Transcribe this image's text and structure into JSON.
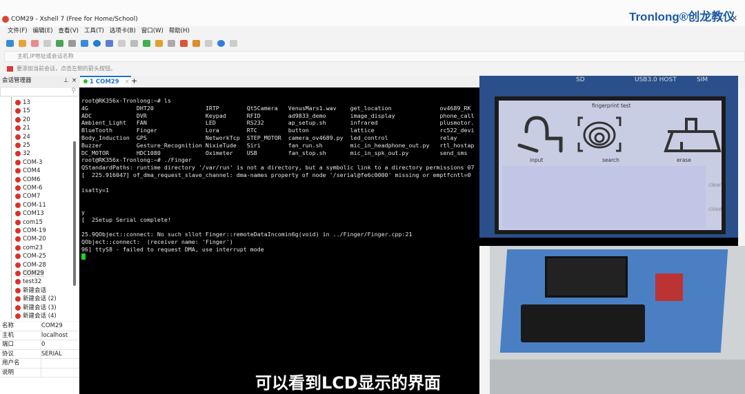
{
  "window": {
    "title": "COM29 - Xshell 7 (Free for Home/School)",
    "logo": "Tronlong®创龙教仪"
  },
  "menu": [
    "文件(F)",
    "编辑(E)",
    "查看(V)",
    "工具(T)",
    "选项卡(B)",
    "窗口(W)",
    "帮助(H)"
  ],
  "address_placeholder": "主机,IP地址或会话名称",
  "hint": "要添加当前会话，点击左侧的箭头按钮。",
  "session_manager": {
    "title": "会话管理器",
    "items": [
      "13",
      "15",
      "20",
      "21",
      "24",
      "25",
      "32",
      "COM-3",
      "COM4",
      "COM6",
      "COM-6",
      "COM7",
      "COM-11",
      "COM13",
      "com15",
      "COM-19",
      "COM-20",
      "com23",
      "COM-25",
      "COM-28",
      "COM29",
      "test32",
      "新建会话",
      "新建会话 (2)",
      "新建会话 (3)",
      "新建会话 (4)"
    ],
    "selected": "COM29"
  },
  "properties": [
    [
      "名称",
      "COM29"
    ],
    [
      "主机",
      "localhost"
    ],
    [
      "端口",
      "0"
    ],
    [
      "协议",
      "SERIAL"
    ],
    [
      "用户名",
      ""
    ],
    [
      "说明",
      ""
    ]
  ],
  "tab": {
    "label": "1 COM29",
    "status_color": "#29c42c"
  },
  "terminal": [
    "root@RK356x-Tronlong:~# ls",
    "4G              DHT20               IRTP        Qt5Camera   VenusMars1.wav    get_location              ov4689_RK",
    "ADC             DVR                 Keypad      RFID        ad9833_demo       image_display             phone_call",
    "Ambient_Light   FAN                 LED         RS232       ap_setup.sh       infrared                  plusmotor.",
    "BlueTooth       Finger              Lora        RTC         button            lattice                   rc522_devi",
    "Body_Induction  GPS                 NetworkTcp  STEP_MOTOR  camera_ov4689.py  led_control               relay",
    "Buzzer          Gesture_Recognition NixieTude   Siri        fan_run.sh        mic_in_headphone_out.py   rtl_hostap",
    "DC_MOTOR        HDC1080             Oximeter    USB         fan_stop.sh       mic_in_spk_out.py         send_sms",
    "root@RK356x-Tronlong:~# ./Finger",
    "QStandardPaths: runtime directory '/var/run' is not a directory, but a symbolic link to a directory permissions 07",
    "[  225.916047] of_dma_request_slave_channel: dma-names property of node '/serial@fe6c0000' missing or emptfcntl=0",
    "",
    "isatty=1",
    "",
    "",
    "y",
    "[  2Setup Serial complete!",
    "",
    "25.9QObject::connect: No such sllot Finger::remoteDataIncomin6g(void) in ../Finger/Finger.cpp:21",
    "QObject::connect:  (receiver name: 'Finger')",
    "96] ttyS8 - failed to request DMA, use interrupt mode"
  ],
  "lcd": {
    "board_labels": [
      "SD",
      "USB3.0 HOST",
      "SIM"
    ],
    "title": "fingerprint test",
    "buttons": [
      "input",
      "search",
      "erase"
    ],
    "side_buttons": [
      "clear",
      "close"
    ]
  },
  "subtitle": "可以看到LCD显示的界面"
}
